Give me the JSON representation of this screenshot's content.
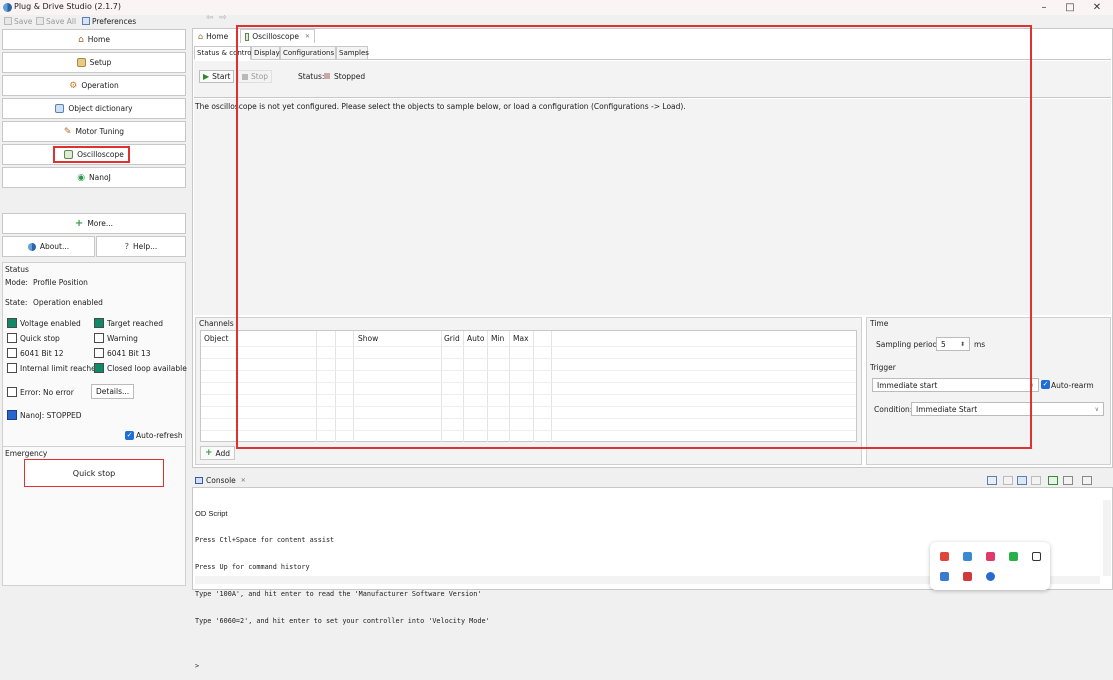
{
  "window": {
    "title": "Plug & Drive Studio (2.1.7)",
    "minimize": "–",
    "maximize": "□",
    "close": "✕"
  },
  "toolbar": {
    "save": "Save",
    "save_all": "Save All",
    "preferences": "Preferences",
    "back": "⇦",
    "forward": "⇨"
  },
  "nav": {
    "home": "Home",
    "setup": "Setup",
    "operation": "Operation",
    "object_dictionary": "Object dictionary",
    "motor_tuning": "Motor Tuning",
    "oscilloscope": "Oscilloscope",
    "nanoj": "NanoJ",
    "more": "More...",
    "about": "About...",
    "help": "Help..."
  },
  "status": {
    "heading": "Status",
    "mode_label": "Mode:",
    "mode_value": "Profile Position",
    "state_label": "State:",
    "state_value": "Operation enabled",
    "indicators": [
      {
        "label": "Voltage enabled",
        "on": true
      },
      {
        "label": "Target reached",
        "on": true
      },
      {
        "label": "Quick stop",
        "on": false
      },
      {
        "label": "Warning",
        "on": false
      },
      {
        "label": "6041 Bit 12",
        "on": false
      },
      {
        "label": "6041 Bit 13",
        "on": false
      },
      {
        "label": "Internal limit reached",
        "on": false
      },
      {
        "label": "Closed loop available",
        "on": true
      }
    ],
    "error_label": "Error: No error",
    "details": "Details...",
    "nanoj_status": "NanoJ: STOPPED",
    "auto_refresh": "Auto-refresh"
  },
  "emergency": {
    "heading": "Emergency",
    "quick_stop": "Quick stop"
  },
  "editor": {
    "tab_home": "Home",
    "tab_osc": "Oscilloscope",
    "tab_close": "✕",
    "subtabs": [
      "Status & control",
      "Display",
      "Configurations",
      "Samples"
    ],
    "start": "Start",
    "stop": "Stop",
    "status_label": "Status:",
    "status_value": "Stopped",
    "message": "The oscilloscope is not yet configured. Please select the objects to sample below, or load a configuration (Configurations -> Load)."
  },
  "channels": {
    "heading": "Channels",
    "columns": [
      "Object",
      "Show",
      "Grid",
      "Auto",
      "Min",
      "Max"
    ],
    "add": "Add"
  },
  "time": {
    "heading": "Time",
    "sampling_label": "Sampling period:",
    "sampling_value": "5",
    "sampling_unit": "ms"
  },
  "trigger": {
    "heading": "Trigger",
    "mode": "Immediate start",
    "auto_rearm": "Auto-rearm",
    "condition_label": "Condition:",
    "condition_value": "Immediate Start"
  },
  "console": {
    "tab": "Console",
    "tab_close": "✕",
    "title": "OD Script",
    "lines": [
      "Press Ctl+Space for content assist",
      "Press Up for command history",
      "Type '100A', and hit enter to read the 'Manufacturer Software Version'",
      "Type '6060=2', and hit enter to set your controller into 'Velocity Mode'",
      "",
      ">"
    ]
  },
  "colors": {
    "led_on": "#0f8a66",
    "highlight": "#e03131",
    "accent": "#1f6fd6"
  }
}
